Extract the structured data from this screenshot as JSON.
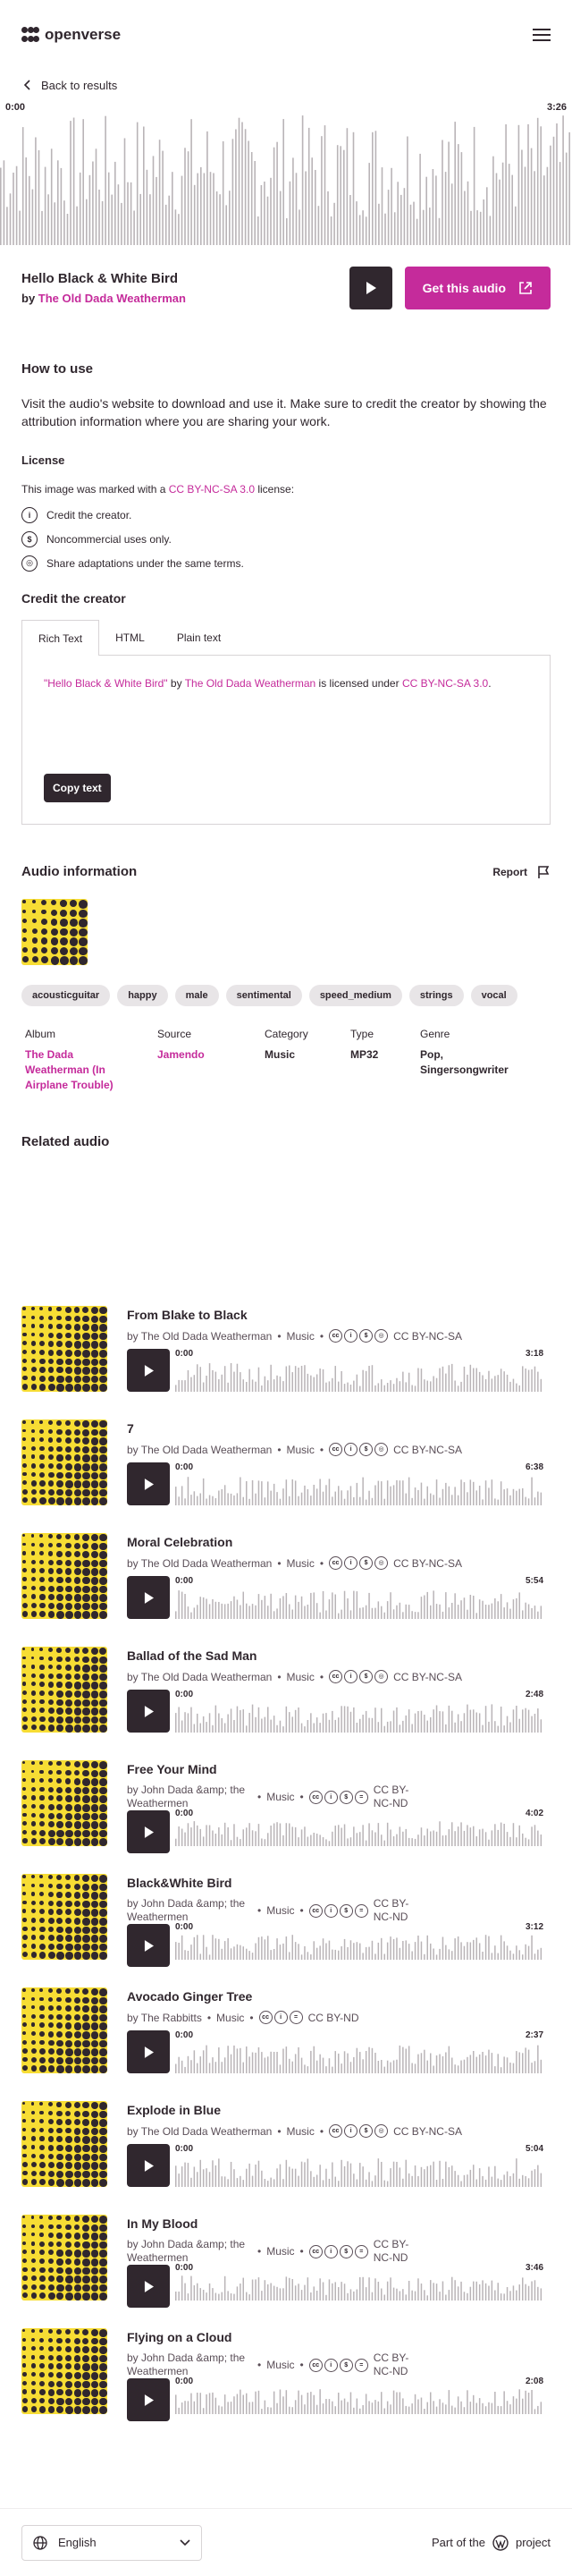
{
  "header": {
    "brand": "openverse",
    "menu_icon": "menu-icon"
  },
  "back": {
    "label": "Back to results"
  },
  "player": {
    "time_start": "0:00",
    "time_end": "3:26"
  },
  "audio": {
    "title": "Hello Black & White Bird",
    "by_label": "by",
    "creator": "The Old Dada Weatherman",
    "get_label": "Get this audio"
  },
  "how_to_use": {
    "heading": "How to use",
    "body": "Visit the audio's website to download and use it. Make sure to credit the creator by showing the attribution information where you are sharing your work."
  },
  "license": {
    "heading": "License",
    "intro_before": "This image was marked with a ",
    "license_name": "CC BY-NC-SA 3.0",
    "intro_after": " license:",
    "items": [
      "Credit the creator.",
      "Noncommercial uses only.",
      "Share adaptations under the same terms."
    ]
  },
  "credit": {
    "heading": "Credit the creator",
    "tabs": [
      "Rich Text",
      "HTML",
      "Plain text"
    ],
    "attr_title": "\"Hello Black & White Bird\"",
    "attr_by": " by ",
    "attr_creator": "The Old Dada Weatherman",
    "attr_mid": " is licensed under ",
    "attr_license": "CC BY-NC-SA 3.0",
    "attr_end": ".",
    "copy_label": "Copy text"
  },
  "info": {
    "heading": "Audio information",
    "report_label": "Report",
    "tags": [
      "acousticguitar",
      "happy",
      "male",
      "sentimental",
      "speed_medium",
      "strings",
      "vocal"
    ],
    "meta": [
      {
        "key": "Album",
        "value": "The Dada Weatherman (In Airplane Trouble)"
      },
      {
        "key": "Source",
        "value": "Jamendo"
      },
      {
        "key": "Category",
        "value": "Music"
      },
      {
        "key": "Type",
        "value": "MP32"
      },
      {
        "key": "Genre",
        "value": "Pop, Singersongwriter"
      }
    ]
  },
  "related": {
    "heading": "Related audio",
    "bullet": "•",
    "items": [
      {
        "title": "From Blake to Black",
        "creator": "by The Old Dada Weatherman",
        "category": "Music",
        "license": "CC BY-NC-SA",
        "icons": [
          "cc",
          "by",
          "nc",
          "sa"
        ],
        "start": "0:00",
        "duration": "3:18"
      },
      {
        "title": "7",
        "creator": "by The Old Dada Weatherman",
        "category": "Music",
        "license": "CC BY-NC-SA",
        "icons": [
          "cc",
          "by",
          "nc",
          "sa"
        ],
        "start": "0:00",
        "duration": "6:38"
      },
      {
        "title": "Moral Celebration",
        "creator": "by The Old Dada Weatherman",
        "category": "Music",
        "license": "CC BY-NC-SA",
        "icons": [
          "cc",
          "by",
          "nc",
          "sa"
        ],
        "start": "0:00",
        "duration": "5:54"
      },
      {
        "title": "Ballad of the Sad Man",
        "creator": "by The Old Dada Weatherman",
        "category": "Music",
        "license": "CC BY-NC-SA",
        "icons": [
          "cc",
          "by",
          "nc",
          "sa"
        ],
        "start": "0:00",
        "duration": "2:48"
      },
      {
        "title": "Free Your Mind",
        "creator": "by John Dada &amp; the Weathermen",
        "category": "Music",
        "license": "CC BY-NC-ND",
        "icons": [
          "cc",
          "by",
          "nc",
          "nd"
        ],
        "start": "0:00",
        "duration": "4:02"
      },
      {
        "title": "Black&White Bird",
        "creator": "by John Dada &amp; the Weathermen",
        "category": "Music",
        "license": "CC BY-NC-ND",
        "icons": [
          "cc",
          "by",
          "nc",
          "nd"
        ],
        "start": "0:00",
        "duration": "3:12"
      },
      {
        "title": "Avocado Ginger Tree",
        "creator": "by The Rabbitts",
        "category": "Music",
        "license": "CC BY-ND",
        "icons": [
          "cc",
          "by",
          "nd"
        ],
        "start": "0:00",
        "duration": "2:37"
      },
      {
        "title": "Explode in Blue",
        "creator": "by The Old Dada Weatherman",
        "category": "Music",
        "license": "CC BY-NC-SA",
        "icons": [
          "cc",
          "by",
          "nc",
          "sa"
        ],
        "start": "0:00",
        "duration": "5:04"
      },
      {
        "title": "In My Blood",
        "creator": "by John Dada &amp; the Weathermen",
        "category": "Music",
        "license": "CC BY-NC-ND",
        "icons": [
          "cc",
          "by",
          "nc",
          "nd"
        ],
        "start": "0:00",
        "duration": "3:46"
      },
      {
        "title": "Flying on a Cloud",
        "creator": "by John Dada &amp; the Weathermen",
        "category": "Music",
        "license": "CC BY-NC-ND",
        "icons": [
          "cc",
          "by",
          "nc",
          "nd"
        ],
        "start": "0:00",
        "duration": "2:08"
      }
    ]
  },
  "footer": {
    "language": "English",
    "part_before": "Part of the",
    "part_after": "project"
  },
  "colors": {
    "accent": "#c52b9b",
    "dark": "#30272e",
    "cover_yellow": "#f7dd34"
  }
}
